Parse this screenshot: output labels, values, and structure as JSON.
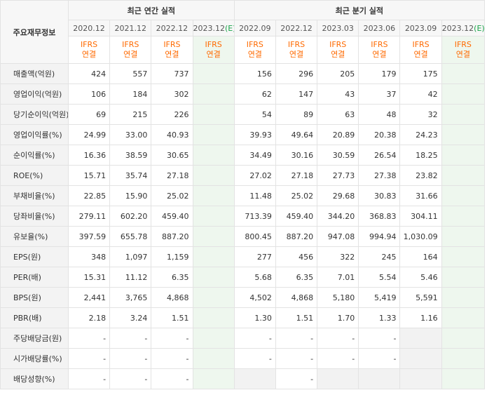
{
  "header": {
    "row_label": "주요재무정보",
    "annual_title": "최근 연간 실적",
    "quarter_title": "최근 분기 실적",
    "annual_periods": [
      "2020.12",
      "2021.12",
      "2022.12",
      "2023.12"
    ],
    "quarter_periods": [
      "2022.09",
      "2022.12",
      "2023.03",
      "2023.06",
      "2023.09",
      "2023.12"
    ],
    "estimate_mark": "(E)",
    "standard_line1": "IFRS",
    "standard_line2": "연결"
  },
  "rows": [
    {
      "label": "매출액(억원)",
      "annual": [
        "424",
        "557",
        "737",
        ""
      ],
      "quarter": [
        "156",
        "296",
        "205",
        "179",
        "175",
        ""
      ]
    },
    {
      "label": "영업이익(억원)",
      "annual": [
        "106",
        "184",
        "302",
        ""
      ],
      "quarter": [
        "62",
        "147",
        "43",
        "37",
        "42",
        ""
      ]
    },
    {
      "label": "당기순이익(억원)",
      "annual": [
        "69",
        "215",
        "226",
        ""
      ],
      "quarter": [
        "54",
        "89",
        "63",
        "48",
        "32",
        ""
      ]
    },
    {
      "label": "영업이익률(%)",
      "annual": [
        "24.99",
        "33.00",
        "40.93",
        ""
      ],
      "quarter": [
        "39.93",
        "49.64",
        "20.89",
        "20.38",
        "24.23",
        ""
      ]
    },
    {
      "label": "순이익률(%)",
      "annual": [
        "16.36",
        "38.59",
        "30.65",
        ""
      ],
      "quarter": [
        "34.49",
        "30.16",
        "30.59",
        "26.54",
        "18.25",
        ""
      ]
    },
    {
      "label": "ROE(%)",
      "annual": [
        "15.71",
        "35.74",
        "27.18",
        ""
      ],
      "quarter": [
        "27.02",
        "27.18",
        "27.73",
        "27.38",
        "23.82",
        ""
      ]
    },
    {
      "label": "부채비율(%)",
      "annual": [
        "22.85",
        "15.90",
        "25.02",
        ""
      ],
      "quarter": [
        "11.48",
        "25.02",
        "29.68",
        "30.83",
        "31.66",
        ""
      ]
    },
    {
      "label": "당좌비율(%)",
      "annual": [
        "279.11",
        "602.20",
        "459.40",
        ""
      ],
      "quarter": [
        "713.39",
        "459.40",
        "344.20",
        "368.83",
        "304.11",
        ""
      ]
    },
    {
      "label": "유보율(%)",
      "annual": [
        "397.59",
        "655.78",
        "887.20",
        ""
      ],
      "quarter": [
        "800.45",
        "887.20",
        "947.08",
        "994.94",
        "1,030.09",
        ""
      ]
    },
    {
      "label": "EPS(원)",
      "annual": [
        "348",
        "1,097",
        "1,159",
        ""
      ],
      "quarter": [
        "277",
        "456",
        "322",
        "245",
        "164",
        ""
      ]
    },
    {
      "label": "PER(배)",
      "annual": [
        "15.31",
        "11.12",
        "6.35",
        ""
      ],
      "quarter": [
        "5.68",
        "6.35",
        "7.01",
        "5.54",
        "5.46",
        ""
      ]
    },
    {
      "label": "BPS(원)",
      "annual": [
        "2,441",
        "3,765",
        "4,868",
        ""
      ],
      "quarter": [
        "4,502",
        "4,868",
        "5,180",
        "5,419",
        "5,591",
        ""
      ]
    },
    {
      "label": "PBR(배)",
      "annual": [
        "2.18",
        "3.24",
        "1.51",
        ""
      ],
      "quarter": [
        "1.30",
        "1.51",
        "1.70",
        "1.33",
        "1.16",
        ""
      ]
    },
    {
      "label": "주당배당금(원)",
      "annual": [
        "-",
        "-",
        "-",
        ""
      ],
      "quarter": [
        "-",
        "-",
        "-",
        "-",
        "",
        ""
      ]
    },
    {
      "label": "시가배당률(%)",
      "annual": [
        "-",
        "-",
        "-",
        ""
      ],
      "quarter": [
        "-",
        "-",
        "-",
        "-",
        "",
        ""
      ]
    },
    {
      "label": "배당성향(%)",
      "annual": [
        "-",
        "-",
        "-",
        ""
      ],
      "quarter": [
        "",
        "-",
        "",
        "",
        "",
        ""
      ]
    }
  ],
  "colors": {
    "estimate_bg": "#eef7ee",
    "ifrs_text": "#ff6a00",
    "estimate_mark": "#1aa54a"
  }
}
